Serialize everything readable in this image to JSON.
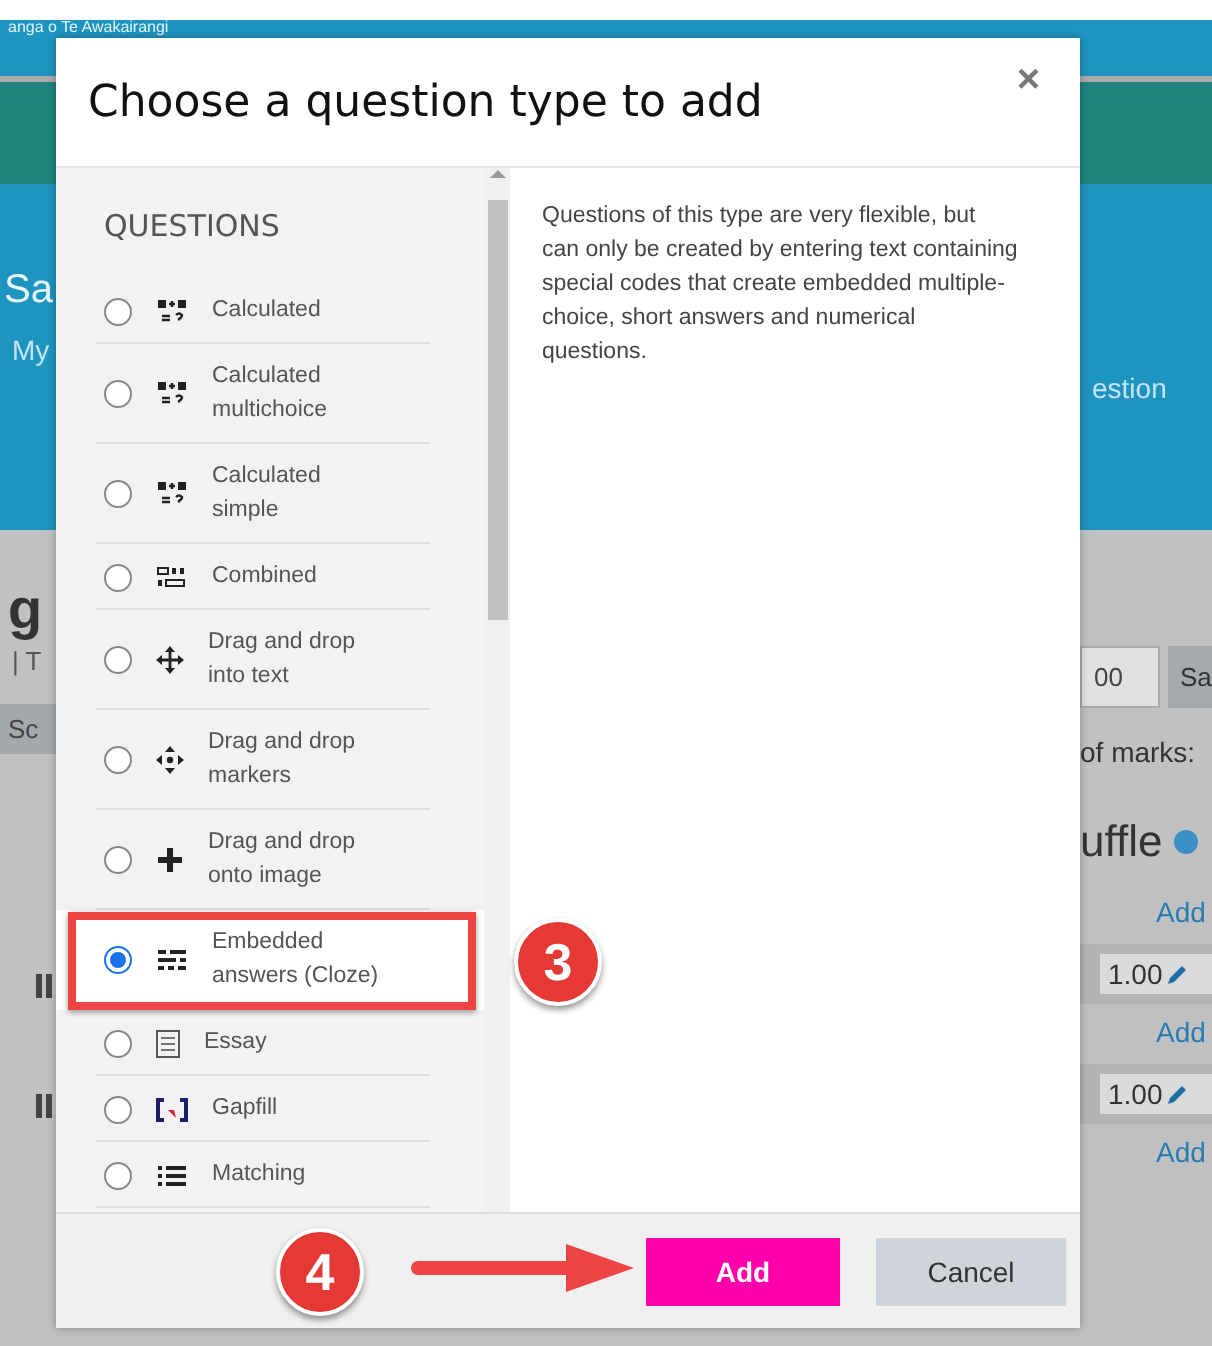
{
  "background_page": {
    "site_name": "anga o Te Awakairangi",
    "course_title": "Sa",
    "nav_item": "My",
    "nav_item_right": "estion",
    "heading": "g",
    "subheading": "| T",
    "left_button": "Sc",
    "max_grade": "00",
    "save_button": "Sa",
    "marks_label": "of marks:",
    "shuffle_heading": "uffle",
    "add_links": [
      "Add",
      "Add",
      "Add"
    ],
    "marks": [
      "1.00",
      "1.00"
    ]
  },
  "dialog": {
    "title": "Choose a question type to add",
    "close": "×",
    "section": "QUESTIONS",
    "questions": [
      {
        "label": "Calculated",
        "kind": "calc",
        "selected": false
      },
      {
        "label": "Calculated multichoice",
        "kind": "calc",
        "selected": false
      },
      {
        "label": "Calculated simple",
        "kind": "calc",
        "selected": false
      },
      {
        "label": "Combined",
        "kind": "combined",
        "selected": false
      },
      {
        "label": "Drag and drop into text",
        "kind": "move",
        "selected": false
      },
      {
        "label": "Drag and drop markers",
        "kind": "markers",
        "selected": false
      },
      {
        "label": "Drag and drop onto image",
        "kind": "cross",
        "selected": false
      },
      {
        "label": "Embedded answers (Cloze)",
        "kind": "cloze",
        "selected": true
      },
      {
        "label": "Essay",
        "kind": "essay",
        "selected": false
      },
      {
        "label": "Gapfill",
        "kind": "gapfill",
        "selected": false
      },
      {
        "label": "Matching",
        "kind": "matching",
        "selected": false
      }
    ],
    "description": "Questions of this type are very flexible, but can only be created by entering text containing special codes that create embedded multiple-choice, short answers and numerical questions.",
    "buttons": [
      {
        "label": "Add",
        "kind": "primary"
      },
      {
        "label": "Cancel",
        "kind": "secondary"
      }
    ]
  },
  "annotations": [
    {
      "label": "3"
    },
    {
      "label": "4"
    }
  ]
}
